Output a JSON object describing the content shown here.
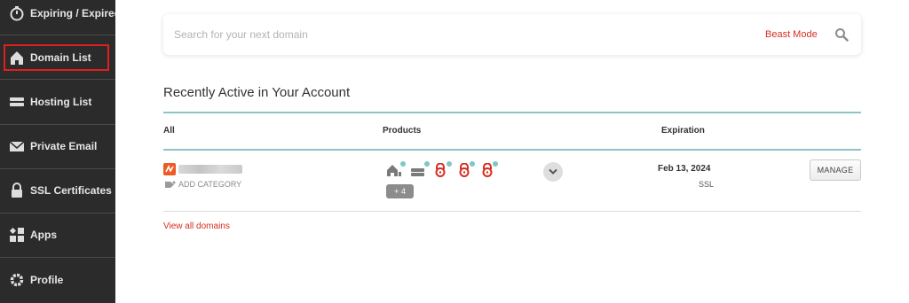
{
  "sidebar": {
    "items": [
      {
        "label": "Expiring / Expired",
        "icon": "stopwatch-icon"
      },
      {
        "label": "Domain List",
        "icon": "house-icon",
        "active": true
      },
      {
        "label": "Hosting List",
        "icon": "server-icon"
      },
      {
        "label": "Private Email",
        "icon": "envelope-icon"
      },
      {
        "label": "SSL Certificates",
        "icon": "lock-icon"
      },
      {
        "label": "Apps",
        "icon": "apps-icon"
      },
      {
        "label": "Profile",
        "icon": "gear-icon"
      }
    ]
  },
  "search": {
    "placeholder": "Search for your next domain",
    "beast_mode_label": "Beast Mode"
  },
  "recent": {
    "title": "Recently Active in Your Account",
    "columns": {
      "all": "All",
      "products": "Products",
      "expiration": "Expiration"
    },
    "row": {
      "add_category": "ADD CATEGORY",
      "more_products": "+ 4",
      "expiration_date": "Feb 13, 2024",
      "expiration_type": "SSL",
      "manage_label": "MANAGE"
    },
    "view_all": "View all domains"
  },
  "colors": {
    "sidebar_bg": "#2b2b2b",
    "accent_red": "#d62d20",
    "teal": "#8fc4c6"
  }
}
